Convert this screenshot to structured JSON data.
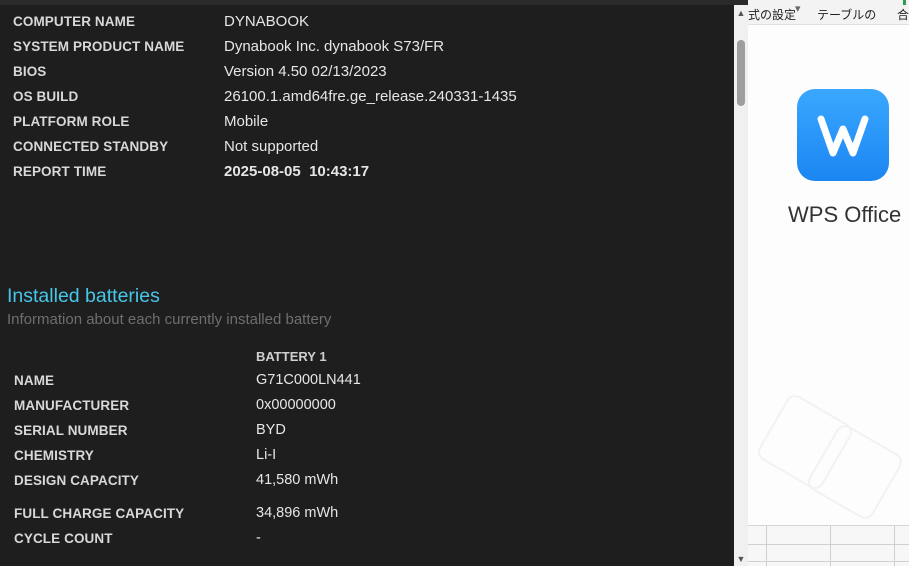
{
  "system_info": [
    {
      "label": "COMPUTER NAME",
      "value": "DYNABOOK"
    },
    {
      "label": "SYSTEM PRODUCT NAME",
      "value": "Dynabook Inc. dynabook S73/FR"
    },
    {
      "label": "BIOS",
      "value": "Version 4.50 02/13/2023"
    },
    {
      "label": "OS BUILD",
      "value": "26100.1.amd64fre.ge_release.240331-1435"
    },
    {
      "label": "PLATFORM ROLE",
      "value": "Mobile"
    },
    {
      "label": "CONNECTED STANDBY",
      "value": "Not supported"
    },
    {
      "label": "REPORT TIME",
      "value": "2025-08-05  10:43:17"
    }
  ],
  "batteries": {
    "title": "Installed batteries",
    "subtitle": "Information about each currently installed battery",
    "column_header": "BATTERY 1",
    "rows": [
      {
        "label": "NAME",
        "value": "G71C000LN441"
      },
      {
        "label": "MANUFACTURER",
        "value": "0x00000000"
      },
      {
        "label": "SERIAL NUMBER",
        "value": "BYD"
      },
      {
        "label": "CHEMISTRY",
        "value": "Li-I"
      },
      {
        "label": "DESIGN CAPACITY",
        "value": "41,580 mWh"
      },
      {
        "label": "FULL CHARGE CAPACITY",
        "value": "34,896 mWh"
      },
      {
        "label": "CYCLE COUNT",
        "value": "-"
      }
    ]
  },
  "background_app": {
    "ribbon_items": [
      "式の設定",
      "テーブルの",
      "合"
    ],
    "splash_name": "WPS Office"
  },
  "colors": {
    "accent_title": "#46c6e8",
    "wps_blue": "#1b86f2"
  }
}
